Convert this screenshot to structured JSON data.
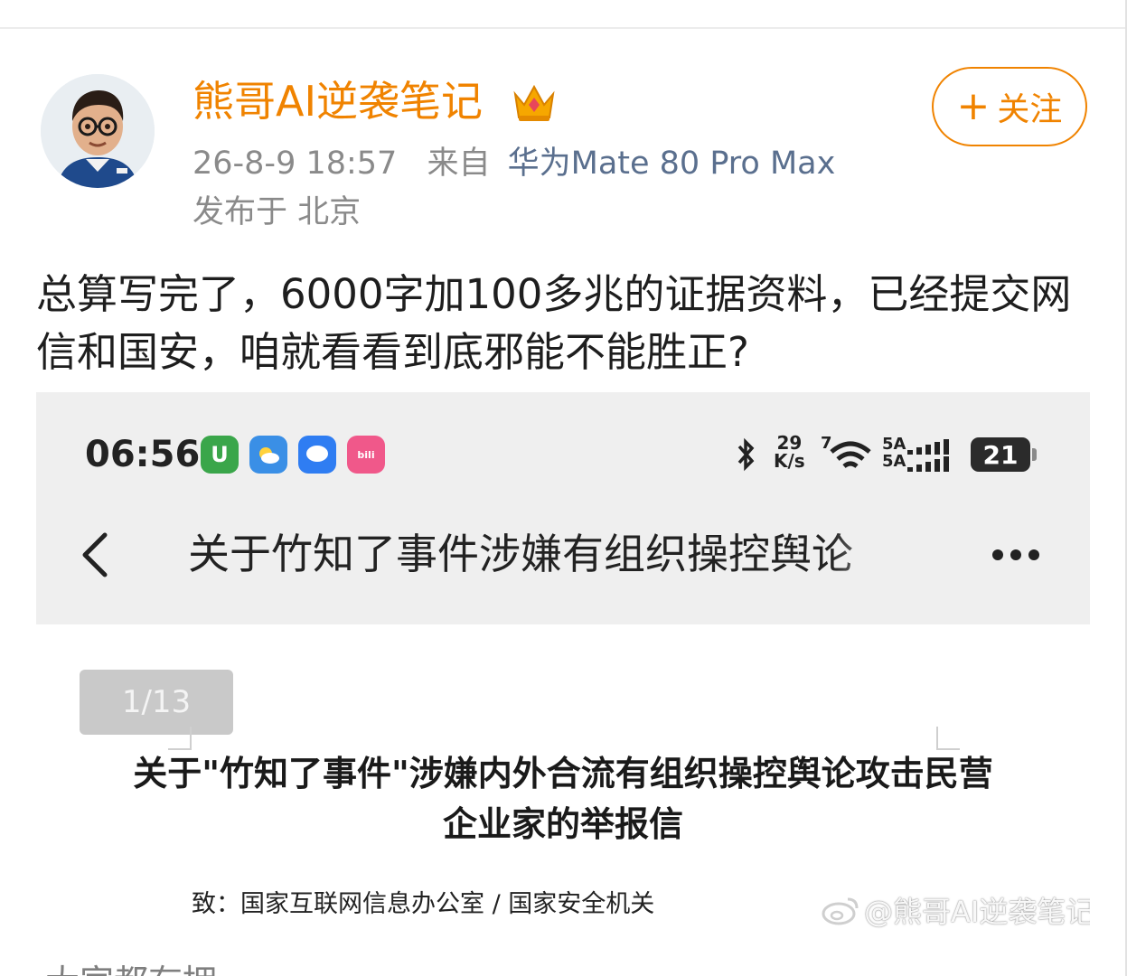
{
  "post": {
    "author": "熊哥AI逆袭笔记",
    "follow_label": "关注",
    "timestamp": "26-8-9 18:57",
    "source_prefix": "来自",
    "device": "华为Mate 80 Pro Max",
    "location": "发布于 北京",
    "text": "总算写完了，6000字加100多兆的证据资料，已经提交网信和国安，咱就看看到底邪能不能胜正?"
  },
  "embedded_screenshot": {
    "status_bar": {
      "time": "06:56",
      "speed_value": "29",
      "speed_unit": "K/s",
      "network_labels": [
        "5A",
        "5A"
      ],
      "wifi_label": "7",
      "battery": "21"
    },
    "header": {
      "title": "关于竹知了事件涉嫌有组织操控舆论"
    },
    "page_indicator": "1/13",
    "letter": {
      "title": "关于\"竹知了事件\"涉嫌内外合流有组织操控舆论攻击民营企业家的举报信",
      "to": "致：国家互联网信息办公室 / 国家安全机关"
    },
    "cutoff_text": "大家都有拥"
  },
  "watermark": "@熊哥AI逆袭笔记",
  "colors": {
    "accent": "#f08300",
    "device_link": "#5a6f8e",
    "meta": "#8a8a8a"
  },
  "icons": [
    "avatar",
    "crown-icon",
    "plus-icon",
    "back-icon",
    "more-icon",
    "bluetooth-icon",
    "wifi-icon",
    "signal-icon",
    "battery-icon",
    "weibo-logo"
  ]
}
